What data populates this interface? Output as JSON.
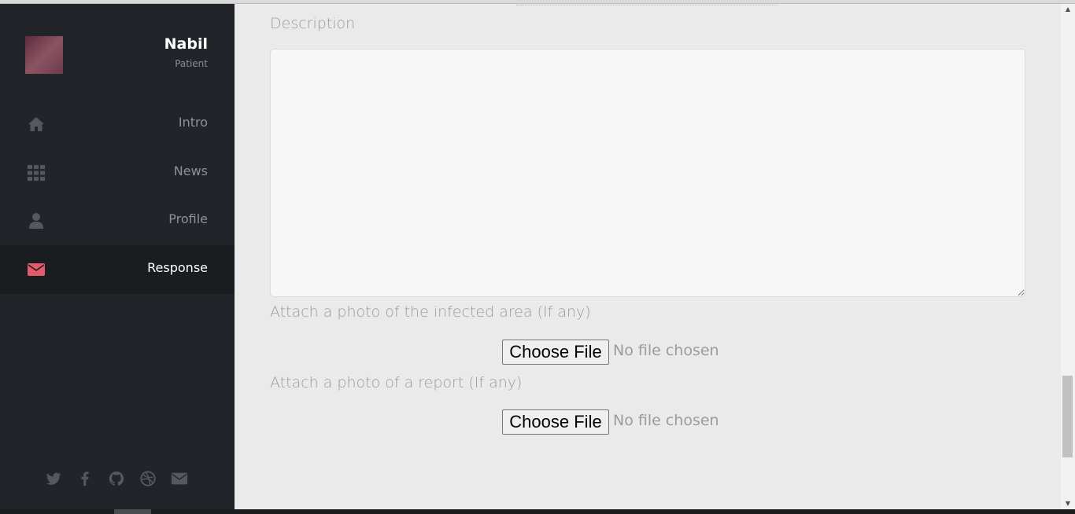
{
  "sidebar": {
    "user": {
      "name": "Nabil",
      "role": "Patient"
    },
    "nav": [
      {
        "label": "Intro",
        "icon": "home-icon",
        "active": false
      },
      {
        "label": "News",
        "icon": "grid-icon",
        "active": false
      },
      {
        "label": "Profile",
        "icon": "user-icon",
        "active": false
      },
      {
        "label": "Response",
        "icon": "envelope-icon",
        "active": true
      }
    ],
    "social": [
      "twitter-icon",
      "facebook-icon",
      "github-icon",
      "dribbble-icon",
      "envelope-icon"
    ],
    "colors": {
      "background": "#212529",
      "active_background": "#1a1d20",
      "accent": "#e35a6d"
    }
  },
  "form": {
    "description_label": "Description",
    "description_value": "",
    "photo_infected_label": "Attach a photo of the infected area (If any)",
    "photo_report_label": "Attach a photo of a report (If any)",
    "choose_file_label": "Choose File",
    "no_file_text": "No file chosen"
  }
}
